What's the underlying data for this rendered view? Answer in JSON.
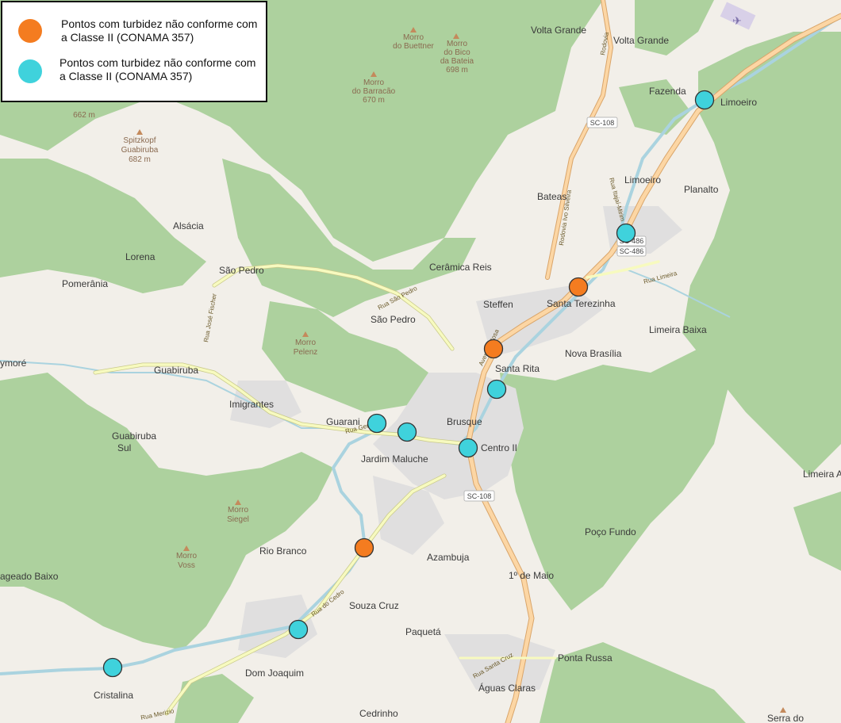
{
  "legend": {
    "items": [
      {
        "label_line1": "Pontos com turbidez não conforme com",
        "label_line2": "a Classe II (CONAMA 357)",
        "color": "#f47c20"
      },
      {
        "label_line1": "Pontos com turbidez não conforme com",
        "label_line2": "a Classe II (CONAMA 357)",
        "color": "#3fd2dc"
      }
    ]
  },
  "places": [
    "Volta Grande",
    "Volta Grande",
    "Fazenda",
    "Limoeiro",
    "Limoeiro",
    "Planalto",
    "Bateas",
    "Alsácia",
    "Lorena",
    "Pomerânia",
    "São Pedro",
    "Cerâmica Reis",
    "Steffen",
    "Santa Terezinha",
    "São Pedro",
    "Limeira Baixa",
    "Nova Brasília",
    "Santa Rita",
    "ymoré",
    "Guabiruba",
    "Imigrantes",
    "Guarani",
    "Brusque",
    "Jardim Maluche",
    "Centro II",
    "Guabiruba",
    "Sul",
    "Limeira A",
    "Poço Fundo",
    "Rio Branco",
    "Azambuja",
    "1º de Maio",
    "ageado Baixo",
    "Souza Cruz",
    "Paquetá",
    "Ponta Russa",
    "Dom Joaquim",
    "Águas Claras",
    "Cristalina",
    "Cedrinho",
    "Serra do"
  ],
  "peaks": [
    "Morro",
    "do Buettner",
    "Morro",
    "do Bico",
    "da Bateia",
    "698 m",
    "Morro",
    "do Barracão",
    "670 m",
    "662 m",
    "Spitzkopf",
    "Guabiruba",
    "682 m",
    "Morro",
    "Pelenz",
    "Morro",
    "Siegel",
    "Morro",
    "Voss"
  ],
  "streets": [
    "Rua São Pedro",
    "Rua José Fischer",
    "Rua Geral",
    "Rua do Cedro",
    "Rua Santa Cruz",
    "Avenida Rosa",
    "Rodovia Ivo Silveira",
    "Rodovia",
    "Rua Limeira",
    "Rua Itajaí-Mirim",
    "Rua Merizio"
  ],
  "shields": [
    "SC-108",
    "SC-486",
    "SC-486",
    "SC-108"
  ],
  "markers": [
    {
      "type": "orange",
      "name": "orange-point-1"
    },
    {
      "type": "orange",
      "name": "orange-point-2"
    },
    {
      "type": "orange",
      "name": "orange-point-3"
    },
    {
      "type": "cyan",
      "name": "cyan-point-1"
    },
    {
      "type": "cyan",
      "name": "cyan-point-2"
    },
    {
      "type": "cyan",
      "name": "cyan-point-3"
    },
    {
      "type": "cyan",
      "name": "cyan-point-4"
    },
    {
      "type": "cyan",
      "name": "cyan-point-5"
    },
    {
      "type": "cyan",
      "name": "cyan-point-6"
    },
    {
      "type": "cyan",
      "name": "cyan-point-7"
    },
    {
      "type": "cyan",
      "name": "cyan-point-8"
    }
  ],
  "colors": {
    "forest": "#add19e",
    "urban": "#e0dfdf",
    "background": "#f2efe9",
    "river": "#aad3df",
    "primary_road": "#fcd6a4",
    "secondary_road": "#f7fabf",
    "orange_point": "#f47c20",
    "cyan_point": "#3fd2dc"
  }
}
